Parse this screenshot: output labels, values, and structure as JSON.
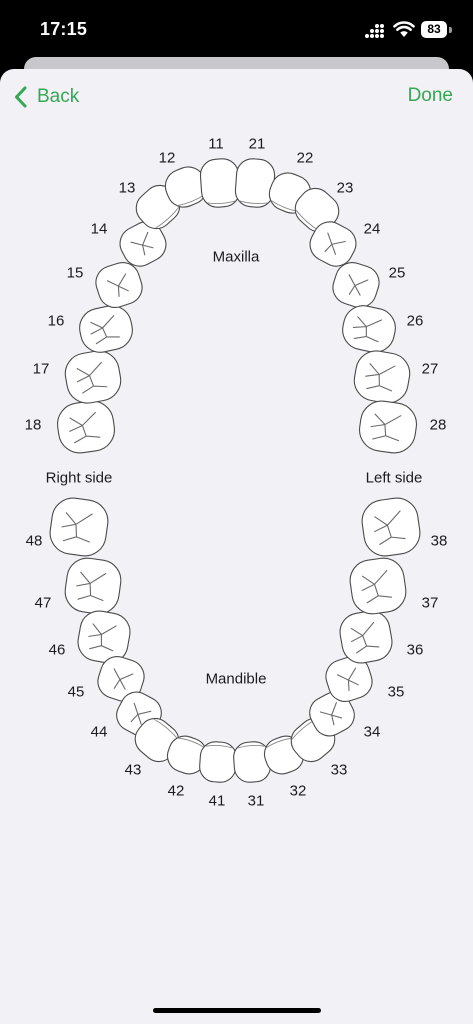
{
  "status_bar": {
    "time": "17:15",
    "battery": "83",
    "icons": [
      "signal-icon",
      "wifi-icon",
      "battery-icon"
    ]
  },
  "nav": {
    "back_label": "Back",
    "done_label": "Done",
    "accent_color": "#34a853"
  },
  "chart": {
    "maxilla_label": "Maxilla",
    "mandible_label": "Mandible",
    "right_side_label": "Right side",
    "left_side_label": "Left side",
    "upper_teeth": [
      "18",
      "17",
      "16",
      "15",
      "14",
      "13",
      "12",
      "11",
      "21",
      "22",
      "23",
      "24",
      "25",
      "26",
      "27",
      "28"
    ],
    "lower_teeth": [
      "48",
      "47",
      "46",
      "45",
      "44",
      "43",
      "42",
      "41",
      "31",
      "32",
      "33",
      "34",
      "35",
      "36",
      "37",
      "38"
    ]
  }
}
